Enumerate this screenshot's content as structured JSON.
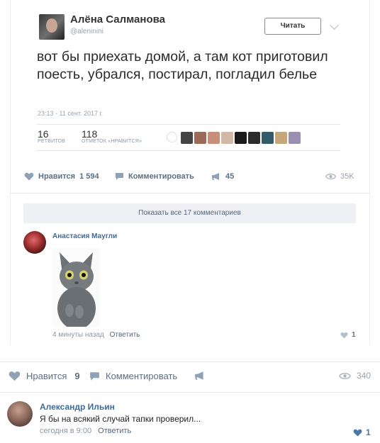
{
  "tweet": {
    "name": "Алёна Салманова",
    "handle": "@alenininі",
    "follow_label": "Читать",
    "text": "вот бы приехать домой, а там кот приготовил поесть, убрался, постирал, погладил белье",
    "time": "23:13 - 11 сент. 2017 г.",
    "retweets": {
      "count": "16",
      "label": "РЕТВИТОВ"
    },
    "likes": {
      "count": "118",
      "label": "ОТМЕТОК «НРАВИТСЯ»"
    },
    "liker_colors": [
      "#ffffff",
      "#444444",
      "#9b6b5a",
      "#c98e7a",
      "#d2b8a7",
      "#1a1a1a",
      "#2b2b2b",
      "#345b6b",
      "#c4a77a",
      "#9a8fb3"
    ]
  },
  "embedded_post": {
    "like_label": "Нравится",
    "like_count": "1 594",
    "comment_label": "Комментировать",
    "share_count": "45",
    "views": "35K",
    "show_all_label": "Показать все 17 комментариев",
    "comment": {
      "author": "Анастасия Маугли",
      "time": "4 минуты назад",
      "reply_label": "Ответить",
      "likes": "1"
    }
  },
  "outer_post": {
    "like_label": "Нравится",
    "like_count": "9",
    "comment_label": "Комментировать",
    "views": "340"
  },
  "comment": {
    "author": "Александр Ильин",
    "text": "Я бы на всякий случай тапки проверил...",
    "time": "сегодня в 9:00",
    "reply_label": "Ответить",
    "likes": "1"
  },
  "colors": {
    "link": "#3f6a99",
    "action": "#5d6f82",
    "muted": "#99a2ad",
    "liked": "#4a76a8"
  }
}
